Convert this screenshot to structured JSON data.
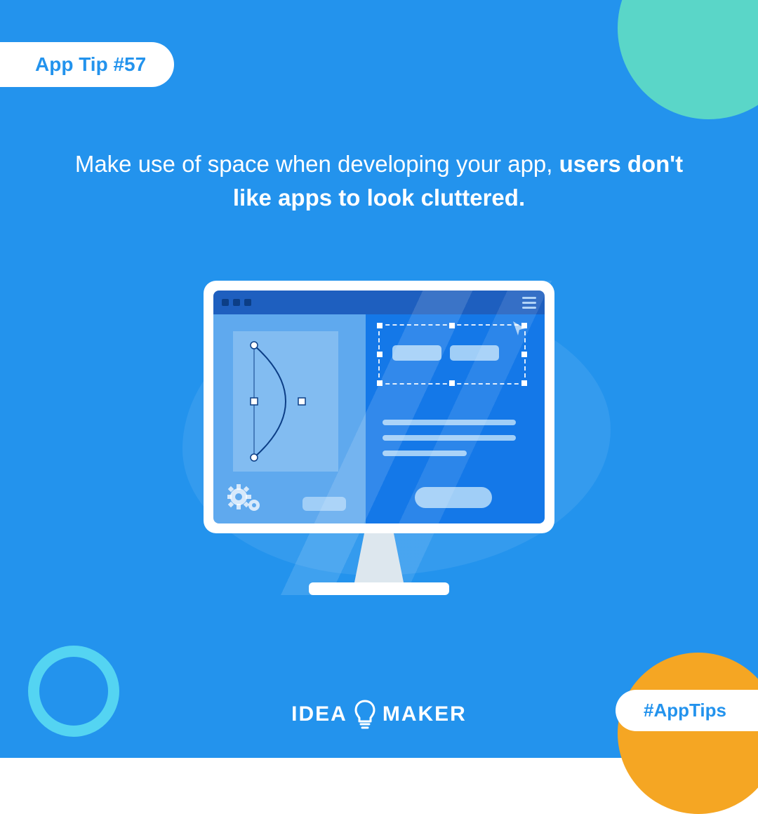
{
  "badge": {
    "label": "App Tip #57"
  },
  "headline": {
    "regular": "Make use of space when developing your app, ",
    "bold": "users don't like apps to look cluttered."
  },
  "hashtag": {
    "label": "#AppTips"
  },
  "logo": {
    "left": "IDEA",
    "right": "MAKER"
  },
  "colors": {
    "background": "#2393ED",
    "teal": "#5AD6C8",
    "orange": "#F5A623",
    "cyan": "#54D4F2",
    "white": "#FFFFFF"
  }
}
